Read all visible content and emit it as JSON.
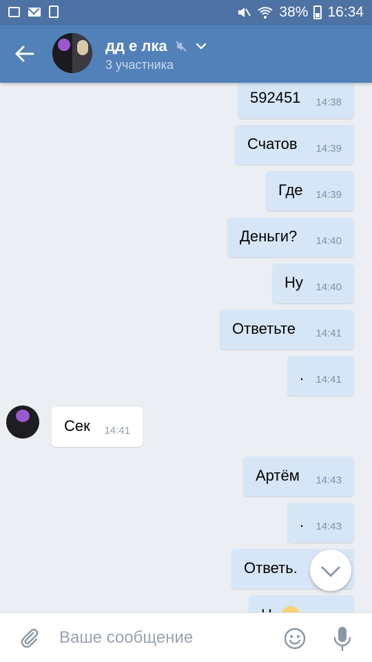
{
  "status_bar": {
    "battery": "38%",
    "time": "16:34"
  },
  "header": {
    "title": "дд е лка",
    "subtitle": "3 участника"
  },
  "messages": [
    {
      "text": "592451",
      "time": "14:38",
      "dir": "out"
    },
    {
      "text": "Счатов",
      "time": "14:39",
      "dir": "out"
    },
    {
      "text": "Где",
      "time": "14:39",
      "dir": "out"
    },
    {
      "text": "Деньги?",
      "time": "14:40",
      "dir": "out"
    },
    {
      "text": "Ну",
      "time": "14:40",
      "dir": "out"
    },
    {
      "text": "Ответьте",
      "time": "14:41",
      "dir": "out"
    },
    {
      "text": ".",
      "time": "14:41",
      "dir": "out"
    },
    {
      "text": "Сек",
      "time": "14:41",
      "dir": "in"
    },
    {
      "text": "Артём",
      "time": "14:43",
      "dir": "out"
    },
    {
      "text": ".",
      "time": "14:43",
      "dir": "out"
    },
    {
      "text": "Ответь.",
      "time": "",
      "dir": "out"
    },
    {
      "text": "Н",
      "time": "",
      "dir": "out"
    }
  ],
  "composer": {
    "placeholder": "Ваше сообщение"
  },
  "colors": {
    "header": "#5181b8",
    "status_bar": "#4d72a3",
    "outgoing_bubble": "#d7e6f7",
    "background": "#ebeef2"
  }
}
